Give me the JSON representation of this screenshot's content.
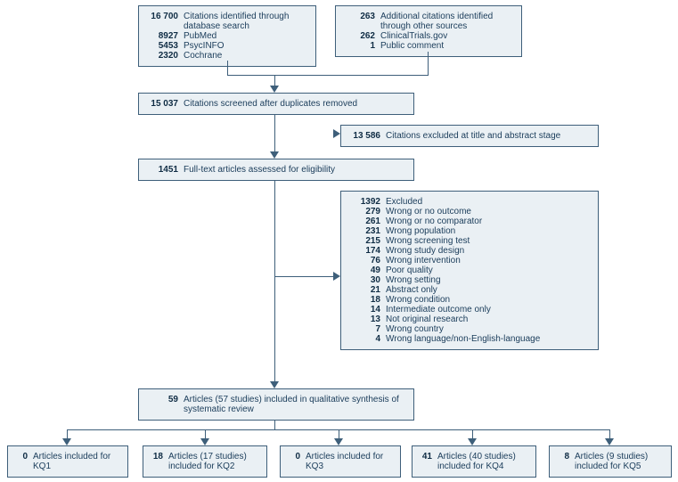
{
  "identification": {
    "db": {
      "total_n": "16 700",
      "total_t": "Citations identified through database search",
      "pubmed_n": "8927",
      "pubmed_t": "PubMed",
      "psyc_n": "5453",
      "psyc_t": "PsycINFO",
      "cochrane_n": "2320",
      "cochrane_t": "Cochrane"
    },
    "other": {
      "total_n": "263",
      "total_t": "Additional citations identified through other sources",
      "ct_n": "262",
      "ct_t": "ClinicalTrials.gov",
      "pc_n": "1",
      "pc_t": "Public comment"
    }
  },
  "screened": {
    "n": "15 037",
    "t": "Citations screened after duplicates removed"
  },
  "excl_title_abs": {
    "n": "13 586",
    "t": "Citations excluded at title and abstract stage"
  },
  "fulltext": {
    "n": "1451",
    "t": "Full-text articles assessed for eligibility"
  },
  "excluded": {
    "total_n": "1392",
    "total_t": "Excluded",
    "items": [
      {
        "n": "279",
        "t": "Wrong or no outcome"
      },
      {
        "n": "261",
        "t": "Wrong or no comparator"
      },
      {
        "n": "231",
        "t": "Wrong population"
      },
      {
        "n": "215",
        "t": "Wrong screening test"
      },
      {
        "n": "174",
        "t": "Wrong study design"
      },
      {
        "n": "76",
        "t": "Wrong intervention"
      },
      {
        "n": "49",
        "t": "Poor quality"
      },
      {
        "n": "30",
        "t": "Wrong setting"
      },
      {
        "n": "21",
        "t": "Abstract only"
      },
      {
        "n": "18",
        "t": "Wrong condition"
      },
      {
        "n": "14",
        "t": "Intermediate outcome only"
      },
      {
        "n": "13",
        "t": "Not original research"
      },
      {
        "n": "7",
        "t": "Wrong country"
      },
      {
        "n": "4",
        "t": "Wrong language/non-English-language"
      }
    ]
  },
  "included": {
    "n": "59",
    "t": "Articles (57 studies) included in qualitative synthesis of systematic review"
  },
  "kq": {
    "kq1": {
      "n": "0",
      "t": "Articles included for KQ1"
    },
    "kq2": {
      "n": "18",
      "t": "Articles (17 studies) included for KQ2"
    },
    "kq3": {
      "n": "0",
      "t": "Articles included for KQ3"
    },
    "kq4": {
      "n": "41",
      "t": "Articles (40 studies) included for KQ4"
    },
    "kq5": {
      "n": "8",
      "t": "Articles (9 studies) included for KQ5"
    }
  },
  "chart_data": {
    "type": "table",
    "title": "PRISMA flow diagram",
    "stages": [
      {
        "stage": "Identification (database)",
        "count": 16700,
        "breakdown": {
          "PubMed": 8927,
          "PsycINFO": 5453,
          "Cochrane": 2320
        }
      },
      {
        "stage": "Identification (other)",
        "count": 263,
        "breakdown": {
          "ClinicalTrials.gov": 262,
          "Public comment": 1
        }
      },
      {
        "stage": "After duplicates removed",
        "count": 15037
      },
      {
        "stage": "Excluded at title/abstract",
        "count": 13586
      },
      {
        "stage": "Full-text assessed",
        "count": 1451
      },
      {
        "stage": "Full-text excluded",
        "count": 1392,
        "breakdown": {
          "Wrong or no outcome": 279,
          "Wrong or no comparator": 261,
          "Wrong population": 231,
          "Wrong screening test": 215,
          "Wrong study design": 174,
          "Wrong intervention": 76,
          "Poor quality": 49,
          "Wrong setting": 30,
          "Abstract only": 21,
          "Wrong condition": 18,
          "Intermediate outcome only": 14,
          "Not original research": 13,
          "Wrong country": 7,
          "Wrong language/non-English-language": 4
        }
      },
      {
        "stage": "Included in qualitative synthesis",
        "count": 59,
        "studies": 57
      },
      {
        "stage": "KQ1",
        "count": 0
      },
      {
        "stage": "KQ2",
        "count": 18,
        "studies": 17
      },
      {
        "stage": "KQ3",
        "count": 0
      },
      {
        "stage": "KQ4",
        "count": 41,
        "studies": 40
      },
      {
        "stage": "KQ5",
        "count": 8,
        "studies": 9
      }
    ]
  }
}
